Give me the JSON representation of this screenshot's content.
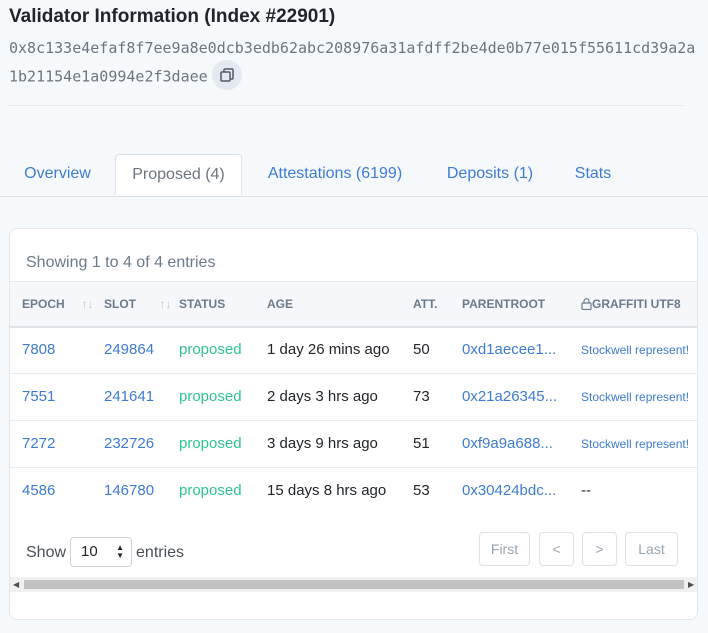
{
  "header": {
    "title": "Validator Information (Index #22901)",
    "address": "0x8c133e4efaf8f7ee9a8e0dcb3edb62abc208976a31afdff2be4de0b77e015f55611cd39a2a1b21154e1a0994e2f3daee",
    "copy_icon": "copy-icon"
  },
  "tabs": [
    {
      "label": "Overview"
    },
    {
      "label": "Proposed (4)"
    },
    {
      "label": "Attestations (6199)"
    },
    {
      "label": "Deposits (1)"
    },
    {
      "label": "Stats"
    }
  ],
  "table": {
    "showing": "Showing 1 to 4 of 4 entries",
    "columns": {
      "epoch": "EPOCH",
      "slot": "SLOT",
      "status": "STATUS",
      "age": "AGE",
      "att": "ATT.",
      "parentroot": "PARENTROOT",
      "graffiti": "GRAFFITI UTF8"
    },
    "sort_glyph": "↑↓",
    "rows": [
      {
        "epoch": "7808",
        "slot": "249864",
        "status": "proposed",
        "age": "1 day 26 mins ago",
        "att": "50",
        "parentroot": "0xd1aecee1...",
        "graffiti": "Stockwell represent!"
      },
      {
        "epoch": "7551",
        "slot": "241641",
        "status": "proposed",
        "age": "2 days 3 hrs ago",
        "att": "73",
        "parentroot": "0x21a26345...",
        "graffiti": "Stockwell represent!"
      },
      {
        "epoch": "7272",
        "slot": "232726",
        "status": "proposed",
        "age": "3 days 9 hrs ago",
        "att": "51",
        "parentroot": "0xf9a9a688...",
        "graffiti": "Stockwell represent!"
      },
      {
        "epoch": "4586",
        "slot": "146780",
        "status": "proposed",
        "age": "15 days 8 hrs ago",
        "att": "53",
        "parentroot": "0x30424bdc...",
        "graffiti": "--"
      }
    ]
  },
  "length_menu": {
    "prefix": "Show",
    "value": "10",
    "suffix": "entries"
  },
  "pagination": {
    "first": "First",
    "prev": "<",
    "next": ">",
    "last": "Last"
  },
  "colors": {
    "link": "#3e7bd4",
    "status": "#2fc495",
    "muted": "#6c757d"
  }
}
